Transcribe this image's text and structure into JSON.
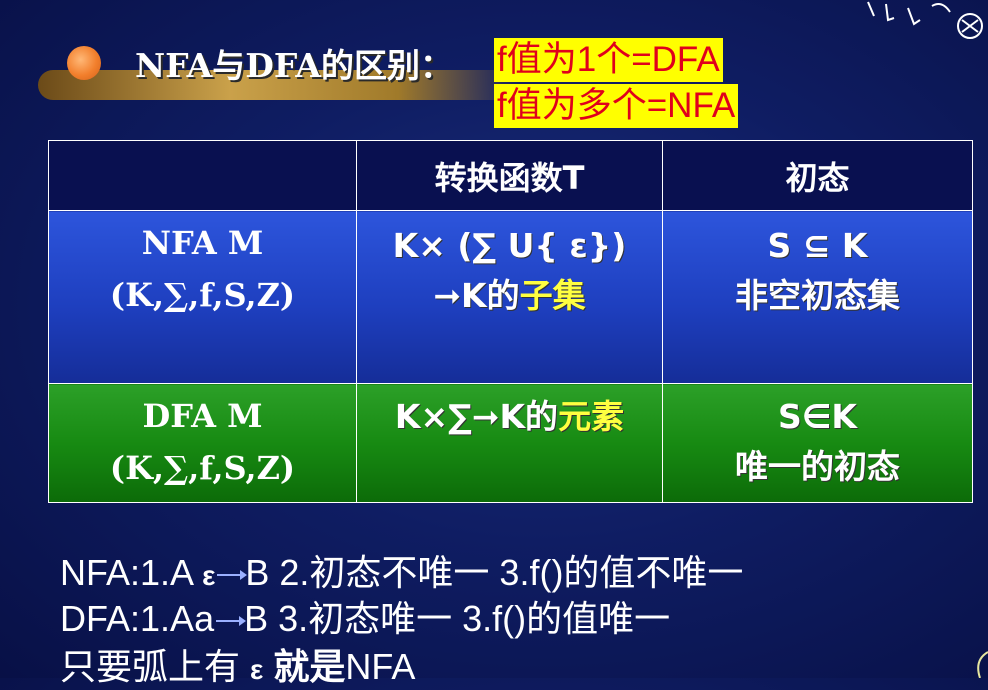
{
  "title": {
    "label": "NFA与DFA的区别：",
    "highlight_1": "f值为1个=DFA",
    "highlight_2": "f值为多个=NFA"
  },
  "table": {
    "header": [
      "",
      "转换函数T",
      "初态"
    ],
    "nfa": {
      "name": "NFA M",
      "tuple": "(K,∑,f,S,Z)",
      "func_line1": "K× (∑ U{ ε})",
      "func_line2_prefix": "➞K的",
      "func_line2_highlight": "子集",
      "init_line1": "S ⊆ K",
      "init_line2": "非空初态集"
    },
    "dfa": {
      "name": "DFA M",
      "tuple": "(K,∑,f,S,Z)",
      "func_prefix": "K×∑➞K的",
      "func_highlight": "元素",
      "init_line1": "S∈K",
      "init_line2": "唯一的初态"
    }
  },
  "notes": {
    "line1_a": "NFA:1.A",
    "line1_arrow_label": "ε",
    "line1_b": "B  2.初态不唯一 3.f()的值不唯一",
    "line2_a": "DFA:1.A",
    "line2_arrow_label": "a",
    "line2_b": "B  3.初态唯一    3.f()的值唯一",
    "line3_a": "只要弧上有",
    "line3_eps": "ε",
    "line3_bold": "就是",
    "line3_c": "NFA"
  },
  "colors": {
    "background": "#0f1d63",
    "nfa_row": "#1e3fbf",
    "dfa_row": "#178a12",
    "highlight_bg": "#ffff00",
    "highlight_text": "#e0001c",
    "yellow_text": "#ffff40",
    "bullet": "#f27f2c"
  }
}
